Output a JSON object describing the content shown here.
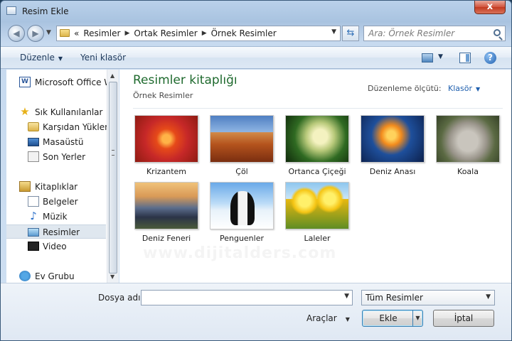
{
  "window": {
    "title": "Resim Ekle",
    "close_label": "x"
  },
  "address": {
    "breadcrumb": [
      "Resimler",
      "Ortak Resimler",
      "Örnek Resimler"
    ],
    "overflow_glyph": "«",
    "search_placeholder": "Ara: Örnek Resimler"
  },
  "toolbar": {
    "organize_label": "Düzenle",
    "new_folder_label": "Yeni klasör",
    "help_label": "?"
  },
  "nav": {
    "items": [
      {
        "label": "Microsoft Office W",
        "icon": "word-icon"
      },
      {
        "label": "Sık Kullanılanlar",
        "icon": "star-icon"
      },
      {
        "label": "Karşıdan Yüklem",
        "icon": "downloads-folder-icon"
      },
      {
        "label": "Masaüstü",
        "icon": "desktop-icon"
      },
      {
        "label": "Son Yerler",
        "icon": "recent-places-icon"
      },
      {
        "label": "Kitaplıklar",
        "icon": "libraries-icon"
      },
      {
        "label": "Belgeler",
        "icon": "documents-icon"
      },
      {
        "label": "Müzik",
        "icon": "music-icon"
      },
      {
        "label": "Resimler",
        "icon": "pictures-icon",
        "selected": true
      },
      {
        "label": "Video",
        "icon": "video-icon"
      },
      {
        "label": "Ev Grubu",
        "icon": "homegroup-icon"
      }
    ]
  },
  "content": {
    "library_title": "Resimler kitaplığı",
    "library_subtitle": "Örnek Resimler",
    "arrange_label": "Düzenleme ölçütü:",
    "arrange_value": "Klasör",
    "files": [
      {
        "name": "Krizantem"
      },
      {
        "name": "Çöl"
      },
      {
        "name": "Ortanca Çiçeği"
      },
      {
        "name": "Deniz Anası"
      },
      {
        "name": "Koala"
      },
      {
        "name": "Deniz Feneri"
      },
      {
        "name": "Penguenler"
      },
      {
        "name": "Laleler"
      }
    ],
    "watermark": "www.dijitalders.com"
  },
  "footer": {
    "filename_label": "Dosya adı:",
    "filename_value": "",
    "filetype_value": "Tüm Resimler",
    "tools_label": "Araçlar",
    "add_label": "Ekle",
    "cancel_label": "İptal"
  }
}
